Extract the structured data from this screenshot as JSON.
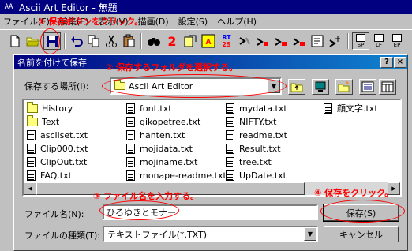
{
  "app": {
    "title": "Ascii Art Editor - 無題",
    "icon_text": "AA"
  },
  "menubar": [
    {
      "label": "ファイル(F)"
    },
    {
      "label": "編集(E)"
    },
    {
      "label": "表示(V)"
    },
    {
      "label": "描画(D)"
    },
    {
      "label": "設定(S)"
    },
    {
      "label": "ヘルプ(H)"
    }
  ],
  "toolbar": {
    "icons": [
      "new-file-icon",
      "open-folder-icon",
      "save-icon",
      "undo-icon",
      "copy-icon",
      "cut-icon",
      "paste-icon",
      "find-icon",
      "number-2-icon",
      "box-icon",
      "text-icon",
      "rt-icon",
      "tool-1-icon",
      "tool-2-icon",
      "tool-3-icon",
      "tool-4-icon",
      "tool-5-icon",
      "view-sp-icon",
      "view-lf-icon",
      "view-ep-icon"
    ],
    "number_2_glyph": "2",
    "rt_top": "RT",
    "rt_bottom": "2S",
    "view_sp": "SP",
    "view_lf": "LF",
    "view_ep": "EP"
  },
  "dialog": {
    "title": "名前を付けて保存",
    "help_glyph": "?",
    "close_glyph": "×",
    "lookin_label": "保存する場所(I):",
    "lookin_value": "Ascii Art Editor",
    "files": [
      {
        "name": "History",
        "type": "folder"
      },
      {
        "name": "Text",
        "type": "folder"
      },
      {
        "name": "asciiset.txt",
        "type": "file"
      },
      {
        "name": "Clip000.txt",
        "type": "file"
      },
      {
        "name": "ClipOut.txt",
        "type": "file"
      },
      {
        "name": "FAQ.txt",
        "type": "file"
      },
      {
        "name": "font.txt",
        "type": "file"
      },
      {
        "name": "gikopetree.txt",
        "type": "file"
      },
      {
        "name": "hanten.txt",
        "type": "file"
      },
      {
        "name": "mojidata.txt",
        "type": "file"
      },
      {
        "name": "mojiname.txt",
        "type": "file"
      },
      {
        "name": "monape-readme.txt",
        "type": "file"
      },
      {
        "name": "mydata.txt",
        "type": "file"
      },
      {
        "name": "NIFTY.txt",
        "type": "file"
      },
      {
        "name": "readme.txt",
        "type": "file"
      },
      {
        "name": "Result.txt",
        "type": "file"
      },
      {
        "name": "tree.txt",
        "type": "file"
      },
      {
        "name": "UpDate.txt",
        "type": "file"
      },
      {
        "name": "顔文字.txt",
        "type": "file"
      }
    ],
    "filename_label": "ファイル名(N):",
    "filename_value": "ひろゆきとモナー",
    "filetype_label": "ファイルの種類(T):",
    "filetype_value": "テキストファイル(*.TXT)",
    "save_button": "保存(S)",
    "cancel_button": "キャンセル"
  },
  "annotations": {
    "step1": "① 保存ボタンをクリック。",
    "step2": "② 保存するフォルダを選択する。",
    "step3": "③ ファイル名を入力する。",
    "step4": "④ 保存をクリック。"
  },
  "colors": {
    "annotation": "#ff0000",
    "titlebar": "#000080",
    "face": "#c0c0c0"
  }
}
